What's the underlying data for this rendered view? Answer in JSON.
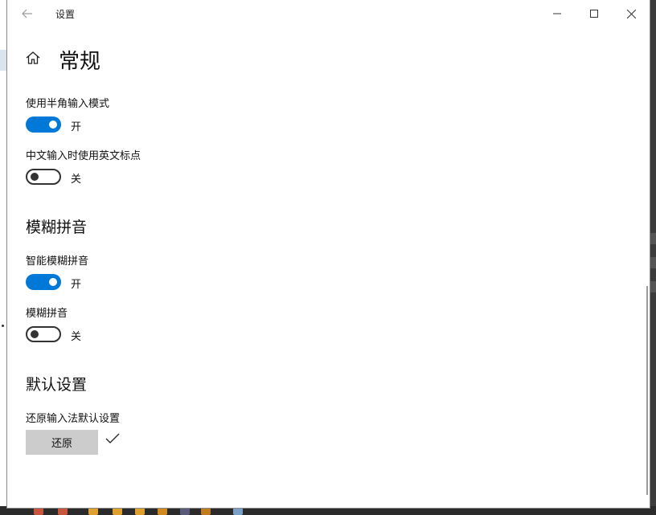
{
  "window": {
    "title": "设置",
    "back_icon": "back-arrow-icon",
    "minimize_icon": "minimize-icon",
    "maximize_icon": "maximize-icon",
    "close_icon": "close-icon"
  },
  "page": {
    "home_icon": "home-icon",
    "title": "常规"
  },
  "settings": {
    "half_width": {
      "label": "使用半角输入模式",
      "state": "开",
      "on": true
    },
    "english_punct": {
      "label": "中文输入时使用英文标点",
      "state": "关",
      "on": false
    }
  },
  "fuzzy": {
    "title": "模糊拼音",
    "smart": {
      "label": "智能模糊拼音",
      "state": "开",
      "on": true
    },
    "fuzzy": {
      "label": "模糊拼音",
      "state": "关",
      "on": false
    }
  },
  "defaults": {
    "title": "默认设置",
    "restore_label": "还原输入法默认设置",
    "restore_button": "还原",
    "done_icon": "checkmark-icon"
  },
  "colors": {
    "accent": "#0078d7",
    "button_bg": "#cccccc"
  }
}
